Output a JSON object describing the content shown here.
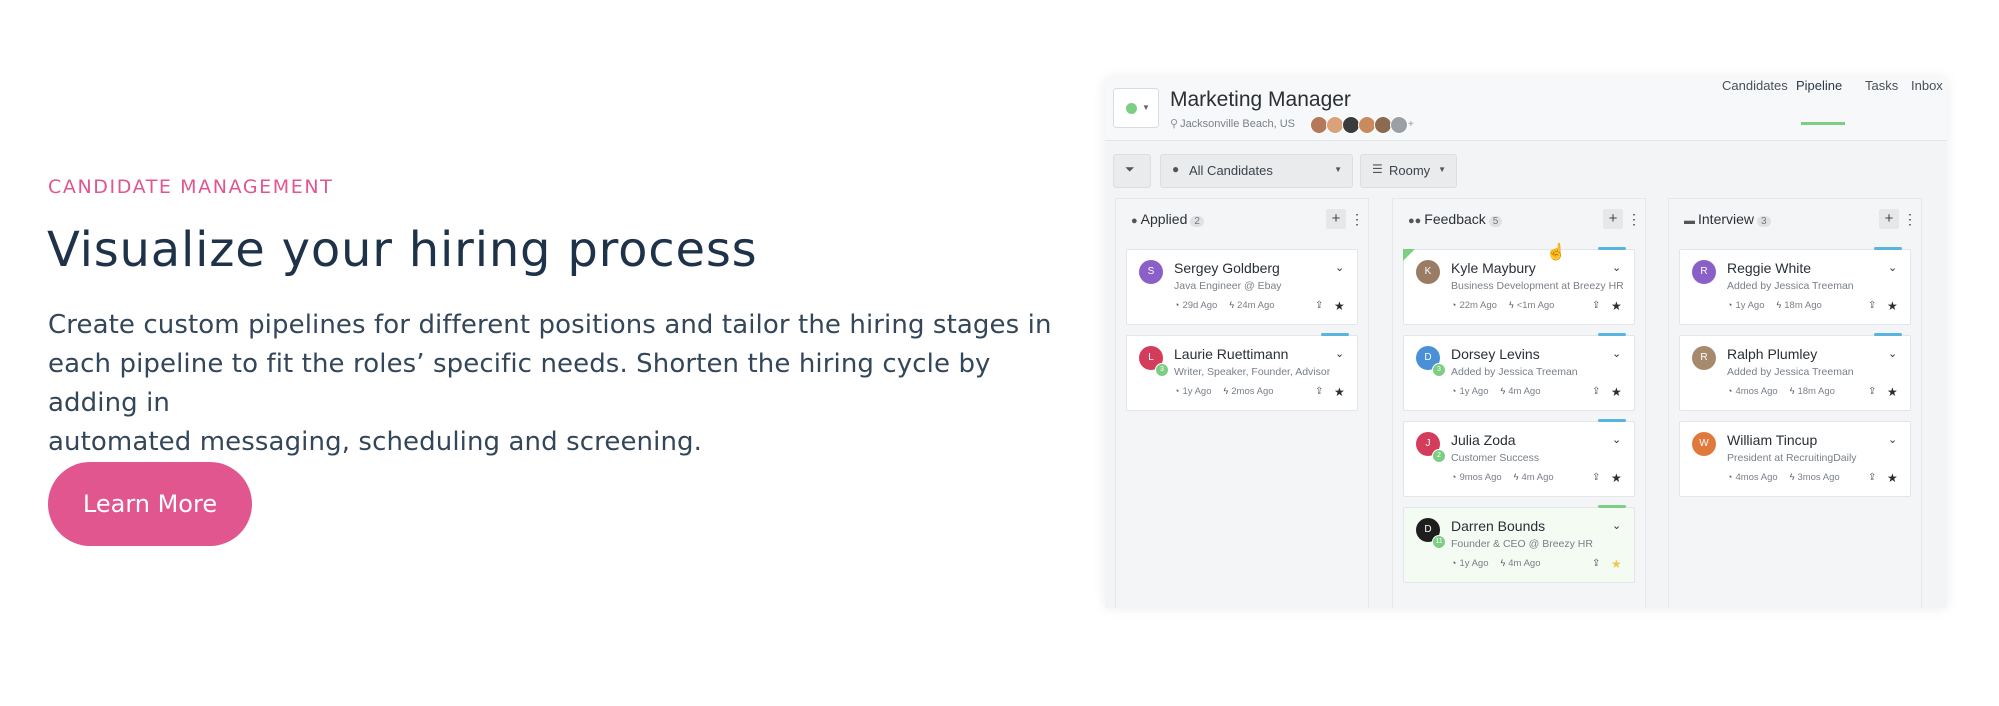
{
  "hero": {
    "eyebrow": "CANDIDATE MANAGEMENT",
    "headline": "Visualize your hiring process",
    "body_lines": [
      "Create custom pipelines for different positions and tailor the hiring stages in",
      "each pipeline to fit the roles’ specific needs. Shorten the hiring cycle by adding in",
      "automated messaging, scheduling and screening."
    ],
    "cta_label": "Learn More"
  },
  "colors": {
    "accent": "#e1568f",
    "heading": "#1e3249",
    "status_green": "#7ccf82",
    "stripe_blue": "#5ab4e0"
  },
  "app": {
    "job_title": "Marketing Manager",
    "location": "Jacksonville Beach, US",
    "team_avatars": [
      "#b4785a",
      "#d9a27a",
      "#3b3b3b",
      "#c98b5e",
      "#8c6a4f",
      "#9aa0a6"
    ],
    "tabs": [
      "Candidates",
      "Pipeline",
      "Tasks",
      "Inbox"
    ],
    "active_tab": "Pipeline",
    "toolbar": {
      "candidates_select": "All Candidates",
      "view_select": "Roomy"
    },
    "columns": [
      {
        "title": "Applied",
        "count": "2",
        "icon": "user-icon",
        "cards": [
          {
            "name": "Sergey Goldberg",
            "subtitle": "Java Engineer @ Ebay",
            "meta1": "29d Ago",
            "meta2": "24m Ago",
            "initial": "S",
            "avatar_color": "#8a5fc8",
            "badge": "",
            "stripe": "",
            "highlight": false,
            "star_gold": false,
            "corner": false
          },
          {
            "name": "Laurie Ruettimann",
            "subtitle": "Writer, Speaker, Founder, Advisor",
            "meta1": "1y Ago",
            "meta2": "2mos Ago",
            "initial": "L",
            "avatar_color": "#d33c5a",
            "badge": "3",
            "stripe": "#5ab4e0",
            "highlight": false,
            "star_gold": false,
            "corner": false
          }
        ]
      },
      {
        "title": "Feedback",
        "count": "5",
        "icon": "team-icon",
        "cards": [
          {
            "name": "Kyle Maybury",
            "subtitle": "Business Development at Breezy HR",
            "meta1": "22m Ago",
            "meta2": "<1m Ago",
            "initial": "K",
            "avatar_color": "#9a7b63",
            "badge": "",
            "stripe": "#5ab4e0",
            "highlight": false,
            "star_gold": false,
            "corner": true
          },
          {
            "name": "Dorsey Levins",
            "subtitle": "Added by Jessica Treeman",
            "meta1": "1y Ago",
            "meta2": "4m Ago",
            "initial": "D",
            "avatar_color": "#4a90d6",
            "badge": "3",
            "stripe": "#5ab4e0",
            "highlight": false,
            "star_gold": false,
            "corner": false
          },
          {
            "name": "Julia Zoda",
            "subtitle": "Customer Success",
            "meta1": "9mos Ago",
            "meta2": "4m Ago",
            "initial": "J",
            "avatar_color": "#d33c5a",
            "badge": "2",
            "stripe": "#5ab4e0",
            "highlight": false,
            "star_gold": false,
            "corner": false
          },
          {
            "name": "Darren Bounds",
            "subtitle": "Founder & CEO @ Breezy HR",
            "meta1": "1y Ago",
            "meta2": "4m Ago",
            "initial": "D",
            "avatar_color": "#1e1e1e",
            "badge": "11",
            "stripe": "#7ccf82",
            "highlight": true,
            "star_gold": true,
            "corner": false
          }
        ]
      },
      {
        "title": "Interview",
        "count": "3",
        "icon": "chat-icon",
        "cards": [
          {
            "name": "Reggie White",
            "subtitle": "Added by Jessica Treeman",
            "meta1": "1y Ago",
            "meta2": "18m Ago",
            "initial": "R",
            "avatar_color": "#8a5fc8",
            "badge": "",
            "stripe": "#5ab4e0",
            "highlight": false,
            "star_gold": false,
            "corner": false
          },
          {
            "name": "Ralph Plumley",
            "subtitle": "Added by Jessica Treeman",
            "meta1": "4mos Ago",
            "meta2": "18m Ago",
            "initial": "R",
            "avatar_color": "#a58a6e",
            "badge": "",
            "stripe": "#5ab4e0",
            "highlight": false,
            "star_gold": false,
            "corner": false
          },
          {
            "name": "William Tincup",
            "subtitle": "President at RecruitingDaily",
            "meta1": "4mos Ago",
            "meta2": "3mos Ago",
            "initial": "W",
            "avatar_color": "#e07a3c",
            "badge": "",
            "stripe": "",
            "highlight": false,
            "star_gold": false,
            "corner": false
          }
        ]
      }
    ]
  }
}
